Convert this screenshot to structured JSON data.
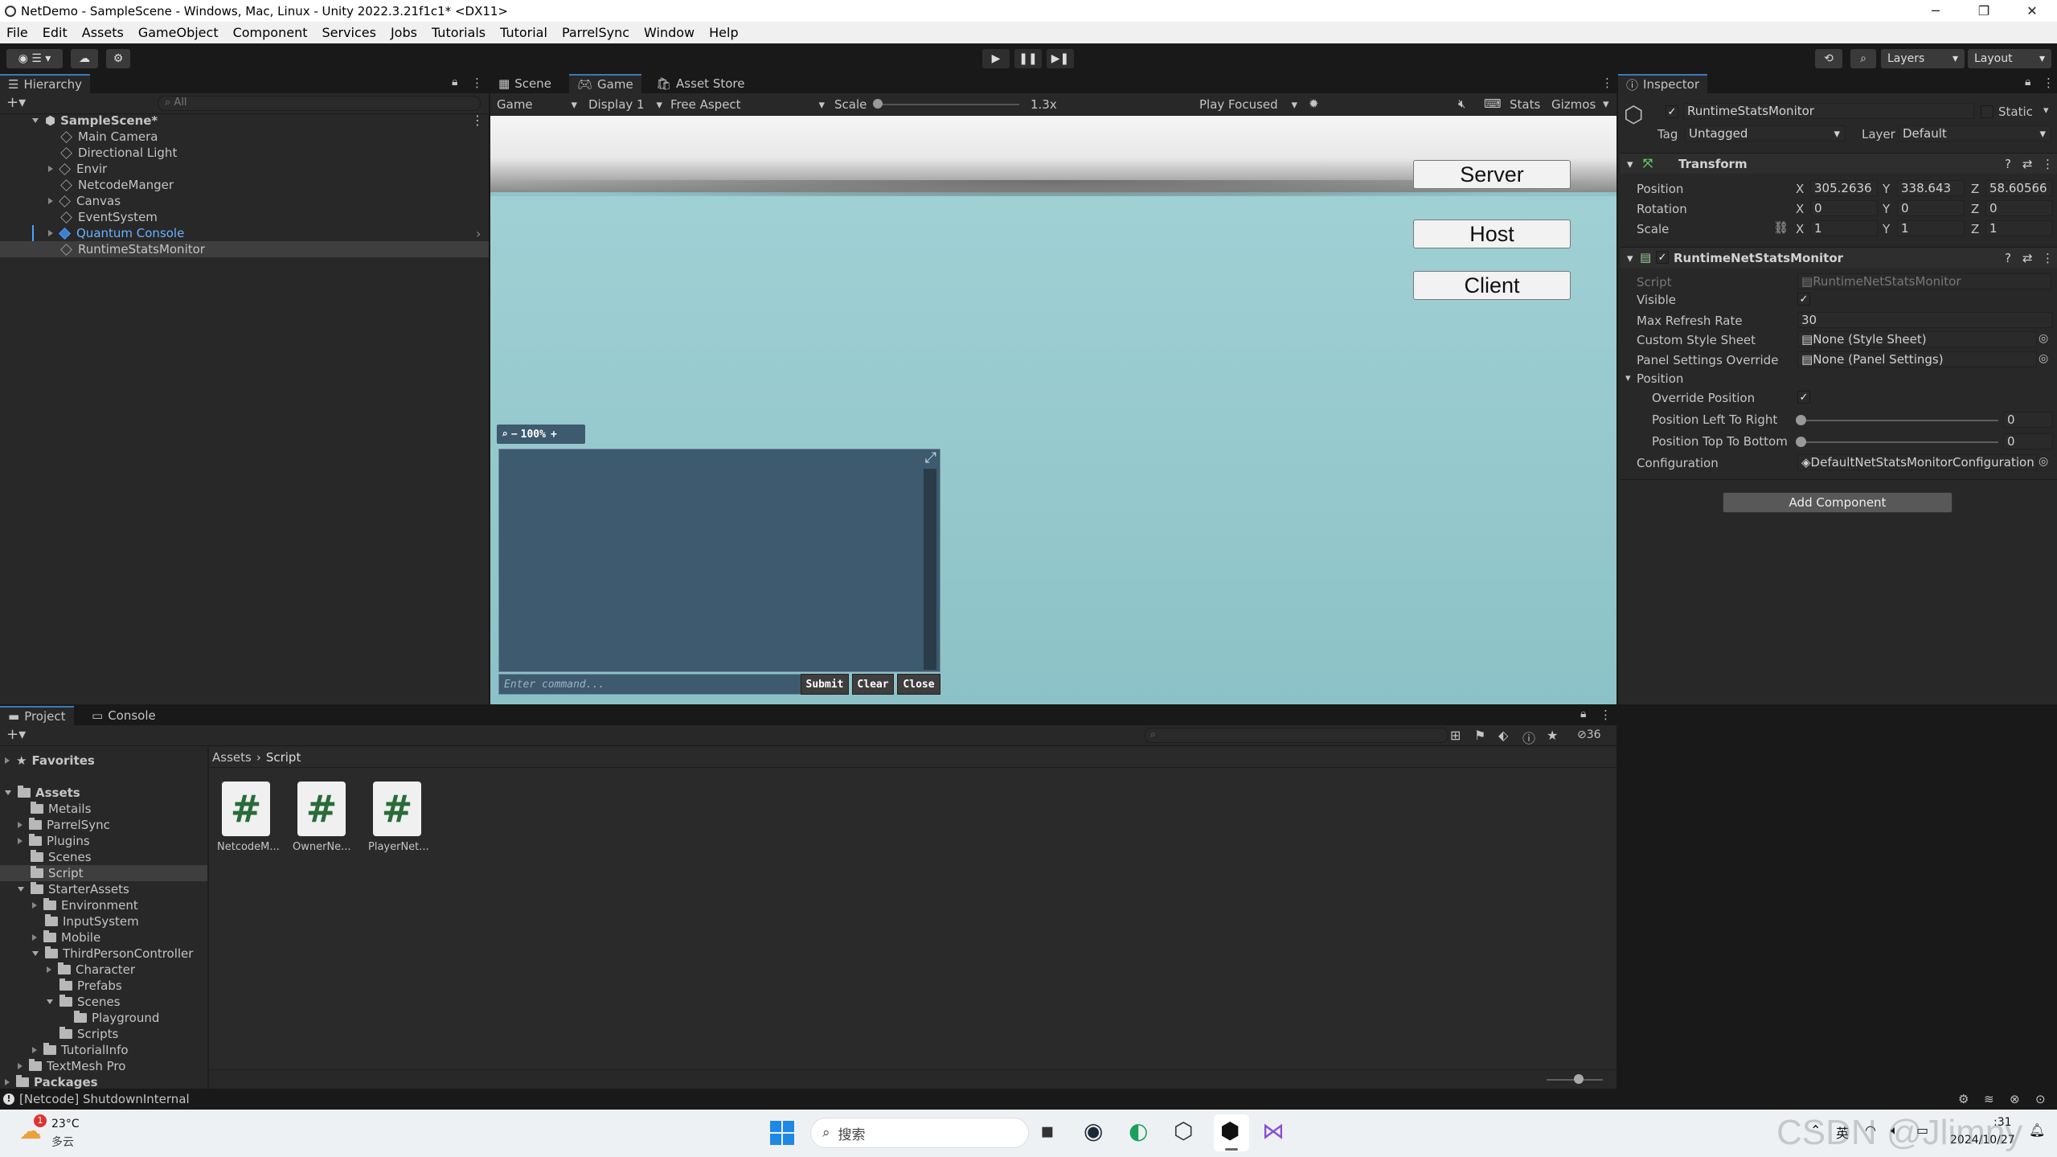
{
  "window": {
    "title": "NetDemo - SampleScene - Windows, Mac, Linux - Unity 2022.3.21f1c1* <DX11>"
  },
  "menu": [
    "File",
    "Edit",
    "Assets",
    "GameObject",
    "Component",
    "Services",
    "Jobs",
    "Tutorials",
    "Tutorial",
    "ParrelSync",
    "Window",
    "Help"
  ],
  "toolbar": {
    "layers_label": "Layers",
    "layout_label": "Layout"
  },
  "hierarchy": {
    "tab": "Hierarchy",
    "search_placeholder": "All",
    "scene": "SampleScene*",
    "items": [
      "Main Camera",
      "Directional Light",
      "Envir",
      "NetcodeManger",
      "Canvas",
      "EventSystem",
      "Quantum Console",
      "RuntimeStatsMonitor"
    ]
  },
  "center_tabs": [
    "Scene",
    "Game",
    "Asset Store"
  ],
  "game_bar": {
    "mode": "Game",
    "display": "Display 1",
    "aspect": "Free Aspect",
    "scale_label": "Scale",
    "scale_value": "1.3x",
    "play_focused": "Play Focused",
    "stats": "Stats",
    "gizmos": "Gizmos"
  },
  "game": {
    "buttons": [
      "Server",
      "Host",
      "Client"
    ],
    "console": {
      "zoom": "100%",
      "input_placeholder": "Enter command...",
      "submit": "Submit",
      "clear": "Clear",
      "close": "Close"
    }
  },
  "inspector": {
    "tab": "Inspector",
    "object_name": "RuntimeStatsMonitor",
    "static_label": "Static",
    "tag_label": "Tag",
    "tag_value": "Untagged",
    "layer_label": "Layer",
    "layer_value": "Default",
    "transform": {
      "title": "Transform",
      "position_label": "Position",
      "rotation_label": "Rotation",
      "scale_label": "Scale",
      "position": {
        "x": "305.2636",
        "y": "338.643",
        "z": "58.60566"
      },
      "rotation": {
        "x": "0",
        "y": "0",
        "z": "0"
      },
      "scale": {
        "x": "1",
        "y": "1",
        "z": "1"
      }
    },
    "component": {
      "title": "RuntimeNetStatsMonitor",
      "script_label": "Script",
      "script_value": "RuntimeNetStatsMonitor",
      "visible_label": "Visible",
      "max_refresh_label": "Max Refresh Rate",
      "max_refresh_value": "30",
      "style_label": "Custom Style Sheet",
      "style_value": "None (Style Sheet)",
      "panel_label": "Panel Settings Override",
      "panel_value": "None (Panel Settings)",
      "position_group": "Position",
      "override_label": "Override Position",
      "left_right_label": "Position Left To Right",
      "left_right_value": "0",
      "top_bottom_label": "Position Top To Bottom",
      "top_bottom_value": "0",
      "config_label": "Configuration",
      "config_value": "DefaultNetStatsMonitorConfiguration ("
    },
    "add_component": "Add Component"
  },
  "bottom_tabs": [
    "Project",
    "Console"
  ],
  "project": {
    "hidden_count": "36",
    "favorites": "Favorites",
    "assets_root": "Assets",
    "tree": [
      "Metails",
      "ParrelSync",
      "Plugins",
      "Scenes",
      "Script",
      "StarterAssets",
      "Environment",
      "InputSystem",
      "Mobile",
      "ThirdPersonController",
      "Character",
      "Prefabs",
      "Scenes",
      "Playground",
      "Scripts",
      "TutorialInfo",
      "TextMesh Pro"
    ],
    "packages": "Packages",
    "breadcrumb": [
      "Assets",
      "Script"
    ],
    "files": [
      "NetcodeM...",
      "OwnerNe...",
      "PlayerNet..."
    ]
  },
  "status": {
    "message": "[Netcode] ShutdownInternal"
  },
  "taskbar": {
    "weather_temp": "23°C",
    "weather_desc": "多云",
    "weather_badge": "1",
    "search_placeholder": "搜索",
    "time": ":31",
    "date": "2024/10/27",
    "ime": "英",
    "watermark": "CSDN @Jlimny"
  }
}
